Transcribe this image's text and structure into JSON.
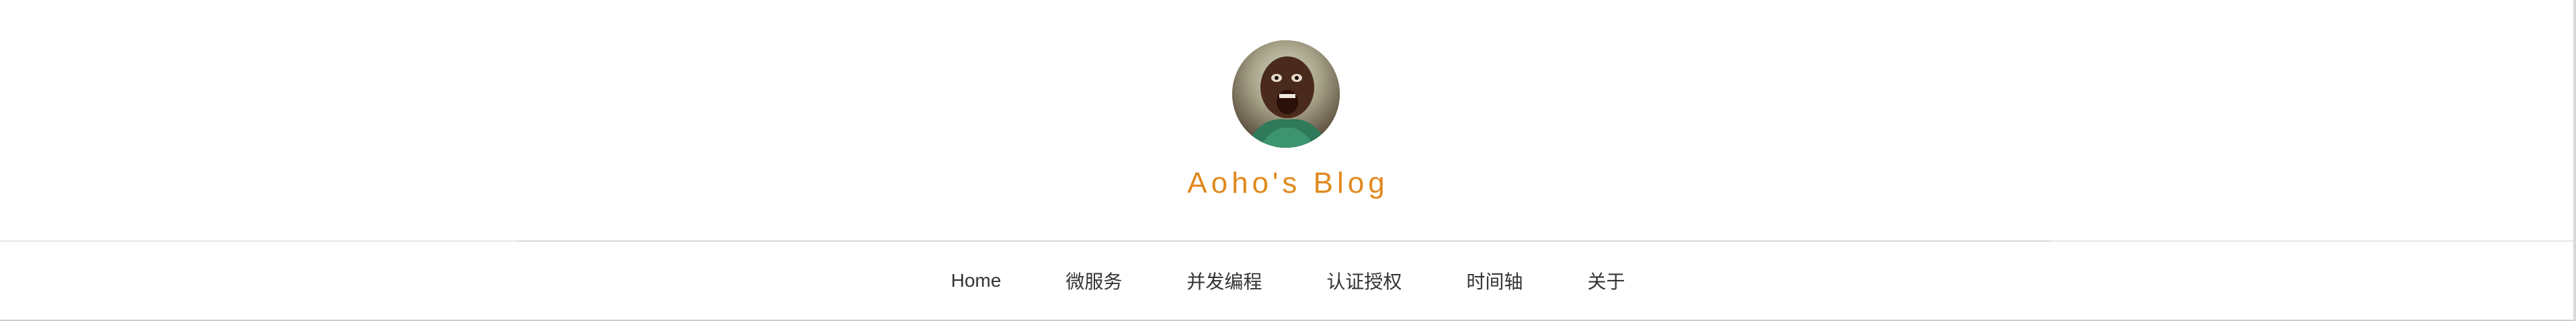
{
  "header": {
    "avatar_alt": "avatar",
    "title": "Aoho's Blog",
    "title_color": "#e08a1e"
  },
  "nav": {
    "items": [
      {
        "label": "Home"
      },
      {
        "label": "微服务"
      },
      {
        "label": "并发编程"
      },
      {
        "label": "认证授权"
      },
      {
        "label": "时间轴"
      },
      {
        "label": "关于"
      }
    ]
  },
  "colors": {
    "background": "#ffffff",
    "nav_text": "#333333",
    "divider": "#e6e6e6"
  }
}
